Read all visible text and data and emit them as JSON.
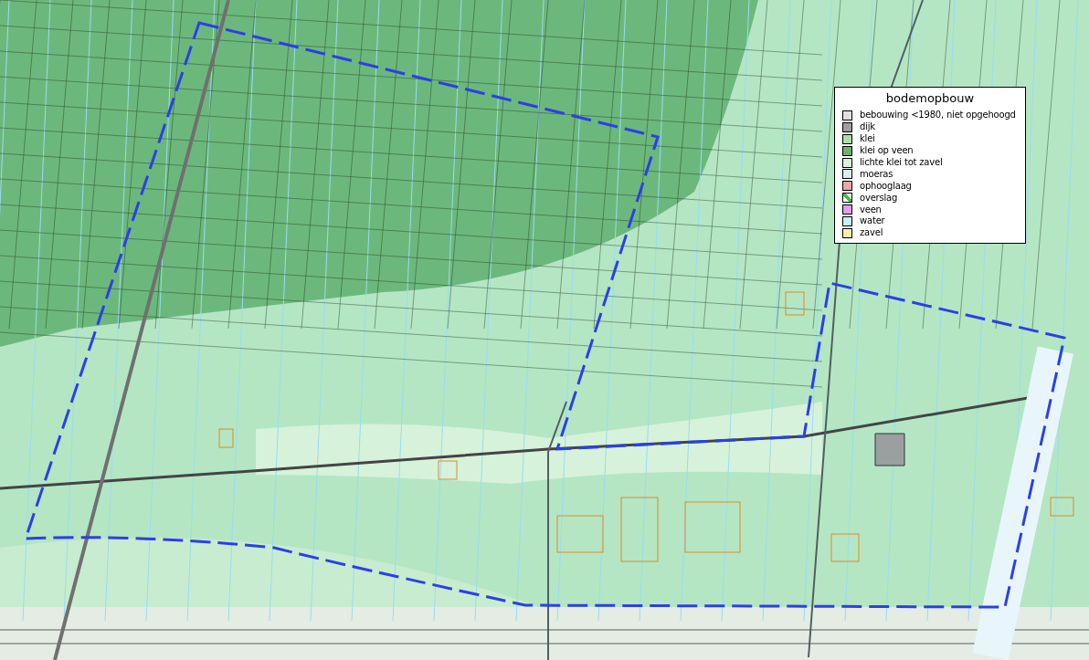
{
  "legend": {
    "title": "bodemopbouw",
    "items": [
      {
        "label": "bebouwing <1980, niet opgehoogd",
        "color": "#e0e0e0",
        "kind": "solid"
      },
      {
        "label": "dijk",
        "color": "#a0a0a0",
        "kind": "solid"
      },
      {
        "label": "klei",
        "color": "#a8e0a8",
        "kind": "solid"
      },
      {
        "label": "klei op veen",
        "color": "#70b070",
        "kind": "solid"
      },
      {
        "label": "lichte klei tot zavel",
        "color": "#d8f4d8",
        "kind": "solid"
      },
      {
        "label": "moeras",
        "color": "#d8f0f0",
        "kind": "solid"
      },
      {
        "label": "ophooglaag",
        "color": "#e8a8a8",
        "kind": "solid"
      },
      {
        "label": "overslag",
        "color": "#40c040",
        "kind": "diagonal"
      },
      {
        "label": "veen",
        "color": "#e0a0e8",
        "kind": "solid"
      },
      {
        "label": "water",
        "color": "#c8f0f8",
        "kind": "solid"
      },
      {
        "label": "zavel",
        "color": "#f8f0b0",
        "kind": "solid"
      }
    ]
  }
}
